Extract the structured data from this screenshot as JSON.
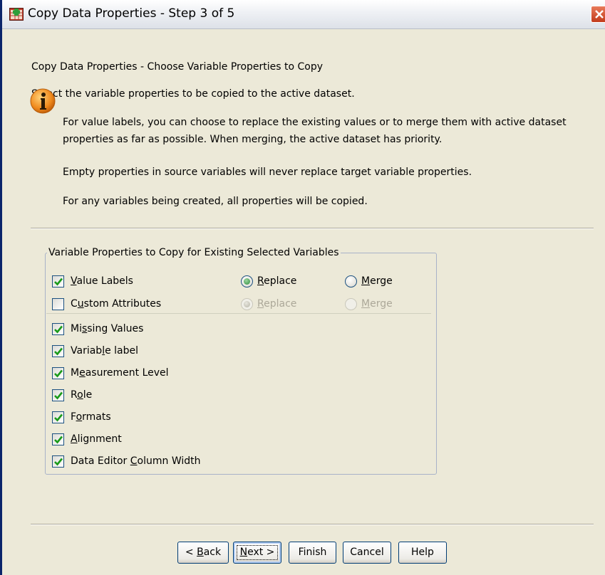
{
  "window": {
    "title": "Copy Data Properties - Step 3 of 5"
  },
  "header": {
    "heading": "Copy Data Properties - Choose Variable Properties to Copy",
    "instruction": "Select the variable properties to be copied to the active dataset."
  },
  "info": {
    "line1": "For value labels, you can choose to replace the existing values or to merge them with active dataset",
    "line2": "properties as far as possible.  When merging, the active dataset has priority.",
    "note1": "Empty properties in source variables will never replace target variable properties.",
    "note2": "For any variables being created, all properties will be copied."
  },
  "group": {
    "legend": "Variable Properties to Copy for Existing Selected Variables",
    "value_labels": {
      "label_pre": "",
      "mnemonic": "V",
      "label_post": "alue Labels",
      "checked": true,
      "replace": {
        "pre": "",
        "mn": "R",
        "post": "eplace",
        "selected": true
      },
      "merge": {
        "pre": "",
        "mn": "M",
        "post": "erge",
        "selected": false
      }
    },
    "custom_attributes": {
      "label_pre": "C",
      "mnemonic": "u",
      "label_post": "stom Attributes",
      "checked": false,
      "replace": {
        "pre": "",
        "mn": "R",
        "post": "eplace",
        "selected": true,
        "enabled": false
      },
      "merge": {
        "pre": "",
        "mn": "M",
        "post": "erge",
        "selected": false,
        "enabled": false
      }
    },
    "items": [
      {
        "pre": "Mi",
        "mn": "s",
        "post": "sing Values",
        "checked": true
      },
      {
        "pre": "Variab",
        "mn": "l",
        "post": "e label",
        "checked": true
      },
      {
        "pre": "M",
        "mn": "e",
        "post": "asurement Level",
        "checked": true
      },
      {
        "pre": "R",
        "mn": "o",
        "post": "le",
        "checked": true
      },
      {
        "pre": "F",
        "mn": "o",
        "post": "rmats",
        "checked": true
      },
      {
        "pre": "",
        "mn": "A",
        "post": "lignment",
        "checked": true
      },
      {
        "pre": "Data Editor ",
        "mn": "C",
        "post": "olumn Width",
        "checked": true
      }
    ]
  },
  "buttons": {
    "back": {
      "pre": "< ",
      "mn": "B",
      "post": "ack"
    },
    "next": {
      "pre": "",
      "mn": "N",
      "post": "ext >"
    },
    "finish": "Finish",
    "cancel": "Cancel",
    "help": "Help"
  }
}
